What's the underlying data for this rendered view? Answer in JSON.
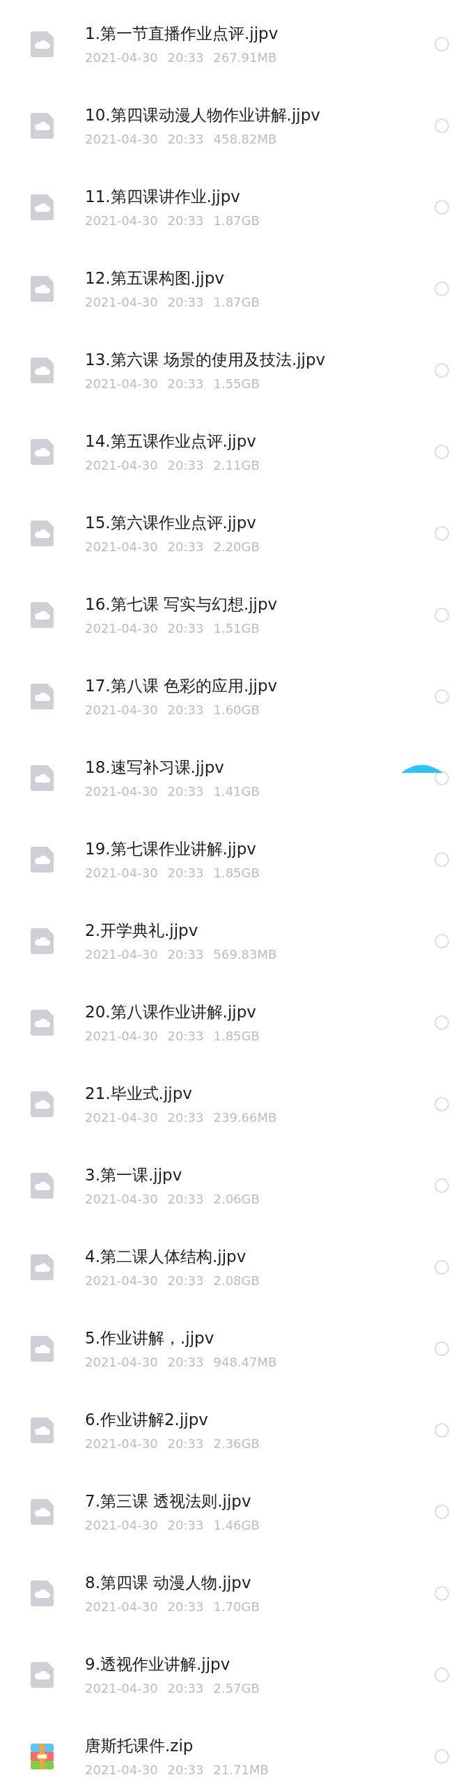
{
  "files": [
    {
      "kind": "video",
      "name": "1.第一节直播作业点评.jjpv",
      "date": "2021-04-30",
      "time": "20:33",
      "size": "267.91MB",
      "selected": false
    },
    {
      "kind": "video",
      "name": "10.第四课动漫人物作业讲解.jjpv",
      "date": "2021-04-30",
      "time": "20:33",
      "size": "458.82MB",
      "selected": false
    },
    {
      "kind": "video",
      "name": "11.第四课讲作业.jjpv",
      "date": "2021-04-30",
      "time": "20:33",
      "size": "1.87GB",
      "selected": false
    },
    {
      "kind": "video",
      "name": "12.第五课构图.jjpv",
      "date": "2021-04-30",
      "time": "20:33",
      "size": "1.87GB",
      "selected": false
    },
    {
      "kind": "video",
      "name": "13.第六课 场景的使用及技法.jjpv",
      "date": "2021-04-30",
      "time": "20:33",
      "size": "1.55GB",
      "selected": false
    },
    {
      "kind": "video",
      "name": "14.第五课作业点评.jjpv",
      "date": "2021-04-30",
      "time": "20:33",
      "size": "2.11GB",
      "selected": false
    },
    {
      "kind": "video",
      "name": "15.第六课作业点评.jjpv",
      "date": "2021-04-30",
      "time": "20:33",
      "size": "2.20GB",
      "selected": false
    },
    {
      "kind": "video",
      "name": "16.第七课 写实与幻想.jjpv",
      "date": "2021-04-30",
      "time": "20:33",
      "size": "1.51GB",
      "selected": false
    },
    {
      "kind": "video",
      "name": "17.第八课 色彩的应用.jjpv",
      "date": "2021-04-30",
      "time": "20:33",
      "size": "1.60GB",
      "selected": false
    },
    {
      "kind": "video",
      "name": "18.速写补习课.jjpv",
      "date": "2021-04-30",
      "time": "20:33",
      "size": "1.41GB",
      "selected": false
    },
    {
      "kind": "video",
      "name": "19.第七课作业讲解.jjpv",
      "date": "2021-04-30",
      "time": "20:33",
      "size": "1.85GB",
      "selected": false
    },
    {
      "kind": "video",
      "name": "2.开学典礼.jjpv",
      "date": "2021-04-30",
      "time": "20:33",
      "size": "569.83MB",
      "selected": false
    },
    {
      "kind": "video",
      "name": "20.第八课作业讲解.jjpv",
      "date": "2021-04-30",
      "time": "20:33",
      "size": "1.85GB",
      "selected": false
    },
    {
      "kind": "video",
      "name": "21.毕业式.jjpv",
      "date": "2021-04-30",
      "time": "20:33",
      "size": "239.66MB",
      "selected": false
    },
    {
      "kind": "video",
      "name": "3.第一课.jjpv",
      "date": "2021-04-30",
      "time": "20:33",
      "size": "2.06GB",
      "selected": false
    },
    {
      "kind": "video",
      "name": "4.第二课人体结构.jjpv",
      "date": "2021-04-30",
      "time": "20:33",
      "size": "2.08GB",
      "selected": false
    },
    {
      "kind": "video",
      "name": "5.作业讲解，.jjpv",
      "date": "2021-04-30",
      "time": "20:33",
      "size": "948.47MB",
      "selected": false
    },
    {
      "kind": "video",
      "name": "6.作业讲解2.jjpv",
      "date": "2021-04-30",
      "time": "20:33",
      "size": "2.36GB",
      "selected": false
    },
    {
      "kind": "video",
      "name": "7.第三课 透视法则.jjpv",
      "date": "2021-04-30",
      "time": "20:33",
      "size": "1.46GB",
      "selected": false
    },
    {
      "kind": "video",
      "name": "8.第四课 动漫人物.jjpv",
      "date": "2021-04-30",
      "time": "20:33",
      "size": "1.70GB",
      "selected": false
    },
    {
      "kind": "video",
      "name": "9.透视作业讲解.jjpv",
      "date": "2021-04-30",
      "time": "20:33",
      "size": "2.57GB",
      "selected": false
    },
    {
      "kind": "zip",
      "name": "唐斯托课件.zip",
      "date": "2021-04-30",
      "time": "20:33",
      "size": "21.71MB",
      "selected": false
    }
  ]
}
